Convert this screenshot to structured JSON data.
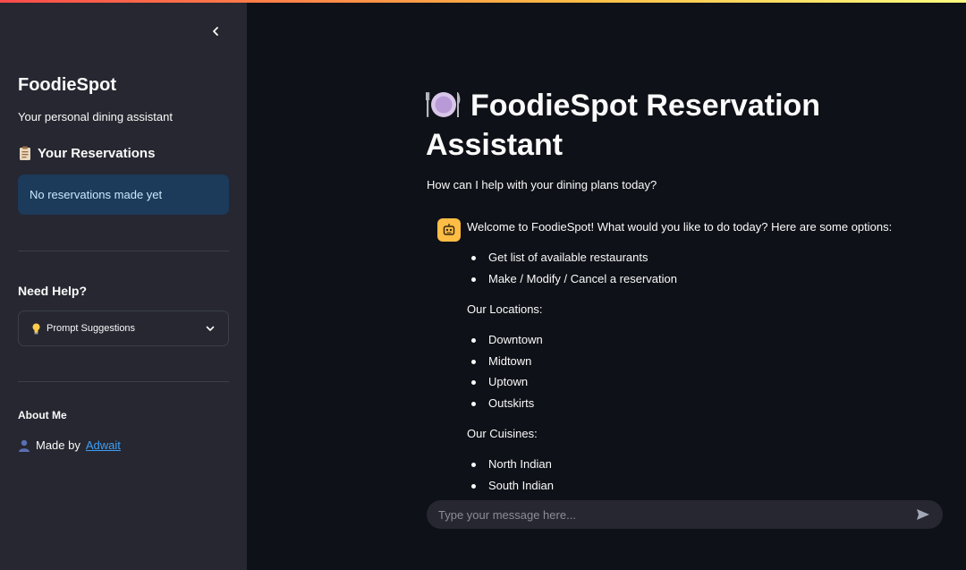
{
  "sidebar": {
    "title": "FoodieSpot",
    "subtitle": "Your personal dining assistant",
    "reservations_heading": "Your Reservations",
    "reservations_empty": "No reservations made yet",
    "help_heading": "Need Help?",
    "prompt_suggestions_label": "Prompt Suggestions",
    "about_heading": "About Me",
    "made_by_prefix": "Made by",
    "made_by_link": "Adwait"
  },
  "main": {
    "title": "FoodieSpot Reservation Assistant",
    "subtitle": "How can I help with your dining plans today?"
  },
  "chat": {
    "message_intro": "Welcome to FoodieSpot! What would you like to do today? Here are some options:",
    "options": [
      "Get list of available restaurants",
      "Make / Modify / Cancel a reservation"
    ],
    "locations_heading": "Our Locations:",
    "locations": [
      "Downtown",
      "Midtown",
      "Uptown",
      "Outskirts"
    ],
    "cuisines_heading": "Our Cuisines:",
    "cuisines": [
      "North Indian",
      "South Indian"
    ],
    "input_placeholder": "Type your message here..."
  },
  "colors": {
    "background": "#0e1117",
    "sidebar": "#262730",
    "info_box": "#1c3a5a",
    "avatar": "#ffbd45",
    "link": "#3e9ef5"
  },
  "icons": {
    "collapse": "chevron-left-icon",
    "reservations": "clipboard-icon",
    "prompt_suggestions": "lightbulb-icon",
    "expander": "chevron-down-icon",
    "made_by": "person-icon",
    "title": "plate-icon",
    "avatar": "robot-icon",
    "send": "send-icon"
  }
}
